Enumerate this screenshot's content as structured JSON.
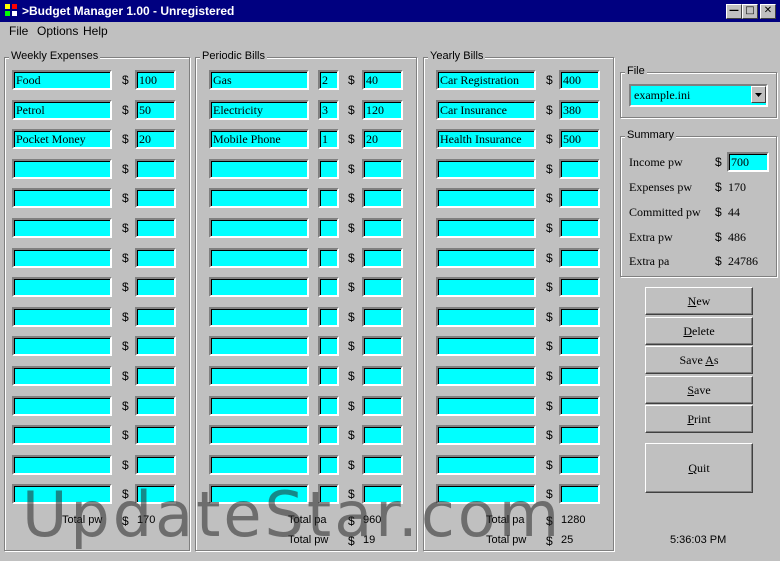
{
  "window": {
    "title": ">Budget Manager 1.00 - Unregistered"
  },
  "menu": [
    "File",
    "Options",
    "Help"
  ],
  "weekly": {
    "title": "Weekly Expenses",
    "rows": [
      {
        "name": "Food",
        "amount": "100"
      },
      {
        "name": "Petrol",
        "amount": "50"
      },
      {
        "name": "Pocket Money",
        "amount": "20"
      },
      {
        "name": "",
        "amount": ""
      },
      {
        "name": "",
        "amount": ""
      },
      {
        "name": "",
        "amount": ""
      },
      {
        "name": "",
        "amount": ""
      },
      {
        "name": "",
        "amount": ""
      },
      {
        "name": "",
        "amount": ""
      },
      {
        "name": "",
        "amount": ""
      },
      {
        "name": "",
        "amount": ""
      },
      {
        "name": "",
        "amount": ""
      },
      {
        "name": "",
        "amount": ""
      },
      {
        "name": "",
        "amount": ""
      },
      {
        "name": "",
        "amount": ""
      }
    ],
    "total_label": "Total pw",
    "total_value": "170"
  },
  "periodic": {
    "title": "Periodic Bills",
    "rows": [
      {
        "name": "Gas",
        "period": "2",
        "amount": "40"
      },
      {
        "name": "Electricity",
        "period": "3",
        "amount": "120"
      },
      {
        "name": "Mobile Phone",
        "period": "1",
        "amount": "20"
      },
      {
        "name": "",
        "period": "",
        "amount": ""
      },
      {
        "name": "",
        "period": "",
        "amount": ""
      },
      {
        "name": "",
        "period": "",
        "amount": ""
      },
      {
        "name": "",
        "period": "",
        "amount": ""
      },
      {
        "name": "",
        "period": "",
        "amount": ""
      },
      {
        "name": "",
        "period": "",
        "amount": ""
      },
      {
        "name": "",
        "period": "",
        "amount": ""
      },
      {
        "name": "",
        "period": "",
        "amount": ""
      },
      {
        "name": "",
        "period": "",
        "amount": ""
      },
      {
        "name": "",
        "period": "",
        "amount": ""
      },
      {
        "name": "",
        "period": "",
        "amount": ""
      },
      {
        "name": "",
        "period": "",
        "amount": ""
      }
    ],
    "total_pa_label": "Total pa",
    "total_pa_value": "960",
    "total_pw_label": "Total pw",
    "total_pw_value": "19"
  },
  "yearly": {
    "title": "Yearly Bills",
    "rows": [
      {
        "name": "Car Registration",
        "amount": "400"
      },
      {
        "name": "Car Insurance",
        "amount": "380"
      },
      {
        "name": "Health Insurance",
        "amount": "500"
      },
      {
        "name": "",
        "amount": ""
      },
      {
        "name": "",
        "amount": ""
      },
      {
        "name": "",
        "amount": ""
      },
      {
        "name": "",
        "amount": ""
      },
      {
        "name": "",
        "amount": ""
      },
      {
        "name": "",
        "amount": ""
      },
      {
        "name": "",
        "amount": ""
      },
      {
        "name": "",
        "amount": ""
      },
      {
        "name": "",
        "amount": ""
      },
      {
        "name": "",
        "amount": ""
      },
      {
        "name": "",
        "amount": ""
      },
      {
        "name": "",
        "amount": ""
      }
    ],
    "total_pa_label": "Total pa",
    "total_pa_value": "1280",
    "total_pw_label": "Total pw",
    "total_pw_value": "25"
  },
  "file_group": {
    "title": "File",
    "selected": "example.ini"
  },
  "summary": {
    "title": "Summary",
    "rows": [
      {
        "label": "Income pw",
        "value": "700"
      },
      {
        "label": "Expenses pw",
        "value": "170"
      },
      {
        "label": "Committed pw",
        "value": "44"
      },
      {
        "label": "Extra pw",
        "value": "486"
      },
      {
        "label": "Extra pa",
        "value": "24786"
      }
    ]
  },
  "buttons": {
    "new": {
      "pre": "",
      "key": "N",
      "post": "ew"
    },
    "delete": {
      "pre": "",
      "key": "D",
      "post": "elete"
    },
    "save_as": {
      "pre": "Save ",
      "key": "A",
      "post": "s"
    },
    "save": {
      "pre": "",
      "key": "S",
      "post": "ave"
    },
    "print": {
      "pre": "",
      "key": "P",
      "post": "rint"
    },
    "quit": {
      "pre": "",
      "key": "Q",
      "post": "uit"
    }
  },
  "currency": "$",
  "clock": "5:36:03 PM",
  "watermark": "UpdateStar.com",
  "colors": {
    "field_bg": "#00ffff",
    "window_bg": "#c0c0c0",
    "titlebar": "#000080"
  }
}
